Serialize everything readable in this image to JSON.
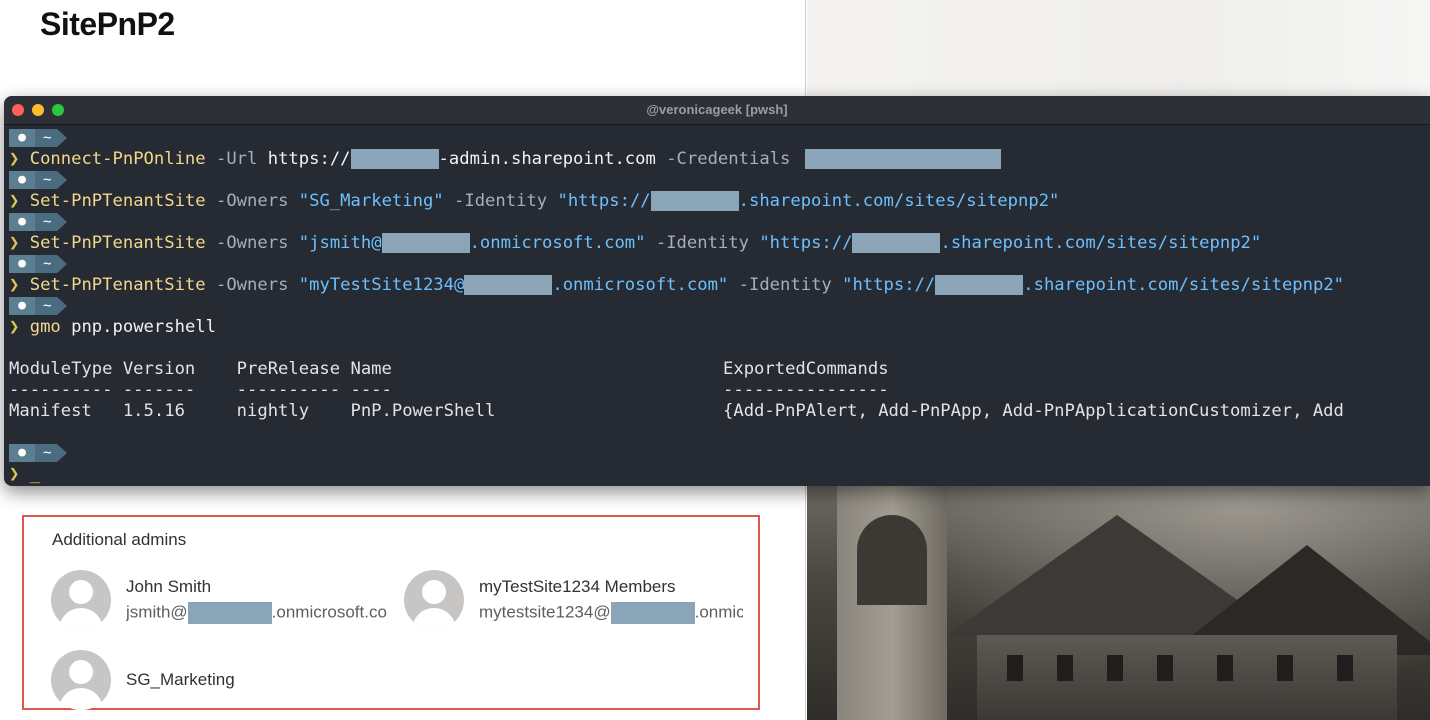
{
  "page": {
    "title": "SitePnP2"
  },
  "terminal": {
    "window_title": "@veronicageek [pwsh]",
    "prompt": {
      "icon": "apple-icon",
      "dir": "~",
      "chevron": "❯"
    },
    "commands": [
      {
        "cmd": "Connect-PnPOnline",
        "p1": " -Url ",
        "v1a": "https://",
        "v1b": "-admin.sharepoint.com",
        "p2": " -Credentials "
      },
      {
        "cmd": "Set-PnPTenantSite",
        "p1": " -Owners ",
        "v1": "\"SG_Marketing\"",
        "p2": " -Identity ",
        "v2a": "\"https://",
        "v2b": ".sharepoint.com/sites/sitepnp2\""
      },
      {
        "cmd": "Set-PnPTenantSite",
        "p1": " -Owners ",
        "v1a": "\"jsmith@",
        "v1b": ".onmicrosoft.com\"",
        "p2": " -Identity ",
        "v2a": "\"https://",
        "v2b": ".sharepoint.com/sites/sitepnp2\""
      },
      {
        "cmd": "Set-PnPTenantSite",
        "p1": " -Owners ",
        "v1a": "\"myTestSite1234@",
        "v1b": ".onmicrosoft.com\"",
        "p2": " -Identity ",
        "v2a": "\"https://",
        "v2b": ".sharepoint.com/sites/sitepnp2\""
      },
      {
        "cmd": "gmo",
        "arg": " pnp.powershell"
      }
    ],
    "output": {
      "header": "ModuleType Version    PreRelease Name                                ExportedCommands",
      "divider": "---------- -------    ---------- ----                                ----------------",
      "row": "Manifest   1.5.16     nightly    PnP.PowerShell                      {Add-PnPAlert, Add-PnPApp, Add-PnPApplicationCustomizer, Add"
    },
    "cursor": "_"
  },
  "admins": {
    "title": "Additional admins",
    "people": [
      {
        "name": "John Smith",
        "email_prefix": "jsmith@",
        "email_suffix": ".onmicrosoft.co"
      },
      {
        "name": "myTestSite1234 Members",
        "email_prefix": "mytestsite1234@",
        "email_suffix": ".onmic"
      },
      {
        "name": "SG_Marketing"
      }
    ]
  },
  "colors": {
    "terminal_bg": "#262a33",
    "redaction": "#8aa4b8",
    "highlight_border": "#e0584b"
  }
}
